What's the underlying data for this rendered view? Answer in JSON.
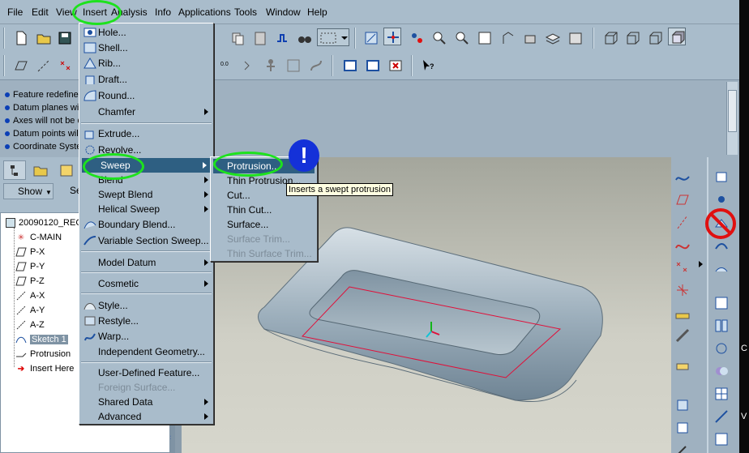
{
  "menubar": {
    "items": [
      "File",
      "Edit",
      "View",
      "Insert",
      "Analysis",
      "Info",
      "Applications",
      "Tools",
      "Window",
      "Help"
    ]
  },
  "messages": [
    "Feature redefined",
    "Datum planes will",
    "Axes will not be d",
    "Datum points will",
    "Coordinate Syste"
  ],
  "left_panel": {
    "show_label": "Show",
    "settings_label": "Se",
    "tree": [
      {
        "label": "20090120_REC",
        "icon": "part-icon"
      },
      {
        "label": "C-MAIN",
        "icon": "csys-icon"
      },
      {
        "label": "P-X",
        "icon": "datum-plane-icon"
      },
      {
        "label": "P-Y",
        "icon": "datum-plane-icon"
      },
      {
        "label": "P-Z",
        "icon": "datum-plane-icon"
      },
      {
        "label": "A-X",
        "icon": "axis-icon"
      },
      {
        "label": "A-Y",
        "icon": "axis-icon"
      },
      {
        "label": "A-Z",
        "icon": "axis-icon"
      },
      {
        "label": "Sketch 1",
        "icon": "sketch-icon"
      },
      {
        "label": "Protrusion",
        "icon": "protrusion-icon"
      },
      {
        "label": "Insert Here",
        "icon": "insert-arrow-icon"
      }
    ]
  },
  "insert_menu": {
    "items": [
      {
        "label": "Hole...",
        "icon": "hole-icon"
      },
      {
        "label": "Shell...",
        "icon": "shell-icon"
      },
      {
        "label": "Rib...",
        "icon": "rib-icon"
      },
      {
        "label": "Draft...",
        "icon": "draft-icon"
      },
      {
        "label": "Round...",
        "icon": "round-icon"
      },
      {
        "label": "Chamfer"
      },
      {
        "label": "Extrude...",
        "icon": "extrude-icon"
      },
      {
        "label": "Revolve...",
        "icon": "revolve-icon"
      },
      {
        "label": "Sweep"
      },
      {
        "label": "Blend"
      },
      {
        "label": "Swept Blend"
      },
      {
        "label": "Helical Sweep"
      },
      {
        "label": "Boundary Blend...",
        "icon": "boundary-blend-icon"
      },
      {
        "label": "Variable Section Sweep...",
        "icon": "var-sweep-icon"
      },
      {
        "label": "Model Datum"
      },
      {
        "label": "Cosmetic"
      },
      {
        "label": "Style...",
        "icon": "style-icon"
      },
      {
        "label": "Restyle...",
        "icon": "restyle-icon"
      },
      {
        "label": "Warp...",
        "icon": "warp-icon"
      },
      {
        "label": "Independent Geometry..."
      },
      {
        "label": "User-Defined Feature..."
      },
      {
        "label": "Foreign Surface..."
      },
      {
        "label": "Shared Data"
      },
      {
        "label": "Advanced"
      }
    ]
  },
  "sweep_submenu": {
    "items": [
      "Protrusion...",
      "Thin Protrusion...",
      "Cut...",
      "Thin Cut...",
      "Surface...",
      "Surface Trim...",
      "Thin Surface Trim..."
    ]
  },
  "tooltip": "Inserts a swept protrusion",
  "callout": "!",
  "colors": {
    "highlight": "#2e5f82",
    "annotation_ring": "#1de21d",
    "callout_blue": "#1431d8",
    "forbidden_red": "#e01010",
    "sketch_line": "#e0103a"
  },
  "right_edge_letters": [
    "C",
    "V"
  ]
}
